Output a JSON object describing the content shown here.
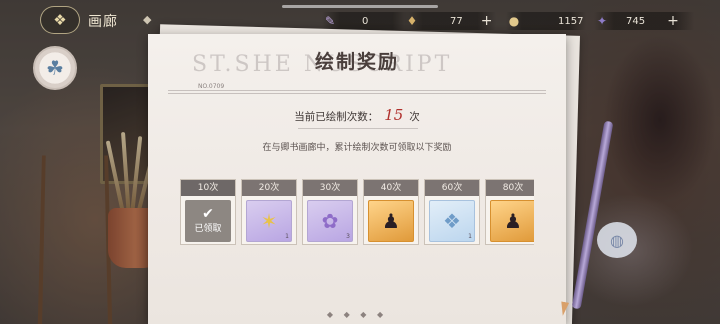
{
  "top_bar": {
    "page_title": "画廊",
    "resources": [
      {
        "icon": "paintbrush-icon",
        "value": "0",
        "color": "#c0a8e0"
      },
      {
        "icon": "ink-icon",
        "value": "77",
        "color": "#d6b16a"
      },
      {
        "icon": "coin-icon",
        "value": "1157",
        "color": "#e2c98c"
      },
      {
        "icon": "gem-icon",
        "value": "745",
        "color": "#8e7cc8"
      }
    ]
  },
  "panel": {
    "title": "绘制奖励",
    "watermark": "ST.SHE          NUSCRIPT",
    "number_label": "NO.0709",
    "count_label": "当前已绘制次数：",
    "count_value": "15",
    "count_unit": "次",
    "hint": "在与卿书画廊中，累计绘制次数可领取以下奖励"
  },
  "rewards": [
    {
      "label": "10次",
      "status": "claimed",
      "claimed_text": "已领取"
    },
    {
      "label": "20次",
      "type": "purple",
      "glyph": "✶",
      "qty": "1"
    },
    {
      "label": "30次",
      "type": "purple",
      "glyph": "✿",
      "qty": "3"
    },
    {
      "label": "40次",
      "type": "orange",
      "glyph": "♟",
      "qty": ""
    },
    {
      "label": "60次",
      "type": "blue",
      "glyph": "❖",
      "qty": "1"
    },
    {
      "label": "80次",
      "type": "orange",
      "glyph": "♟",
      "qty": ""
    }
  ]
}
